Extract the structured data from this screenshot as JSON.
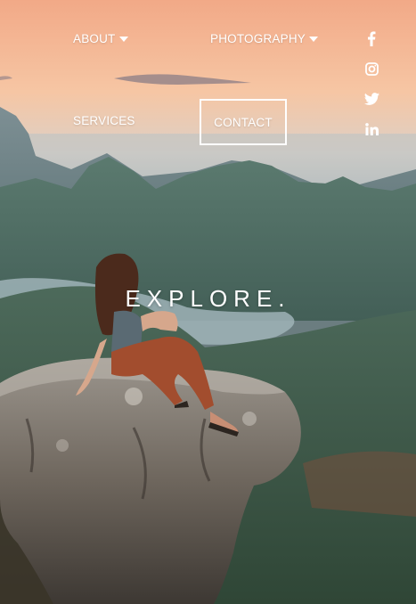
{
  "nav": {
    "about": "ABOUT",
    "photography": "PHOTOGRAPHY",
    "services": "SERVICES",
    "contact": "CONTACT"
  },
  "social": [
    "facebook-icon",
    "instagram-icon",
    "twitter-icon",
    "linkedin-icon"
  ],
  "hero": {
    "title": "EXPLORE."
  },
  "colors": {
    "sky_top": "#f3a98a",
    "sky_mid": "#f6c8a3",
    "mountain": "#4f6e68",
    "text": "#ffffff"
  }
}
